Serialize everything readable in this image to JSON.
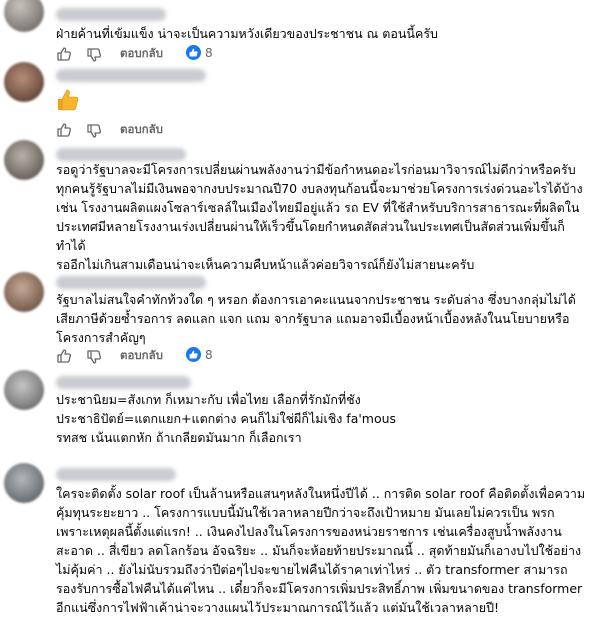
{
  "reply_label": "ตอบกลับ",
  "comments": [
    {
      "text": "ฝ่ายค้านที่เข้มแข็ง น่าจะเป็นความหวังเดียวของประชาชน ณ ตอนนี้ครับ",
      "reaction_count": "8"
    },
    {
      "text": "",
      "emoji": "thumbs-up"
    },
    {
      "text": "รอดูว่ารัฐบาลจะมีโครงการเปลี่ยนผ่านพลังงานว่ามีข้อกำหนดอะไรก่อนมาวิจารณ์ไม่ดีกว่าหรือครับ\nทุกคนรู้รัฐบาลไม่มีเงินพอจากงบประมาณปี70 งบลงทุนก้อนนี้จะมาช่วยโครงการเร่งด่วนอะไรได้บ้าง\nเช่น โรงงานผลิตแผงโซลาร์เซลล์ในเมืองไทยมีอยู่แล้ว รถ EV ที่ใช้สำหรับบริการสาธารณะที่ผลิตใน\nประเทศมีหลายโรงงานเร่งเปลี่ยนผ่านให้เร็วขึ้นโดยกำหนดสัดส่วนในประเทศเป็นสัดส่วนเพิ่มขึ้นก็ทำได้\nรออีกไม่เกินสามเดือนน่าจะเห็นความคืบหน้าแล้วค่อยวิจารณ์ก็ยังไม่สายนะครับ"
    },
    {
      "text": "รัฐบาลไม่สนใจคำทักท้วงใด ๆ หรอก ต้องการเอาคะแนนจากประชาชน ระดับล่าง ซึ่งบางกลุ่มไม่ได้\nเสียภาษีด้วยซ้ำรอการ ลดแลก แจก แถม จากรัฐบาล แถมอาจมีเบื้องหน้าเบื้องหลังในนโยบายหรือ\nโครงการสำคัญๆ",
      "reaction_count": "8"
    },
    {
      "text": "ประชานิยม=สังเกท ก็เหมาะกับ เพื่อไทย เลือกที่รักมักที่ชัง\nประชาธิปัตย์=แตกแยก+แตกต่าง คนก็ไม่ใช่ผีก็ไม่เชิง fa'mous\nรทสช เน้นแตกหัก ถ้าเกลียดมันมาก ก็เลือกเรา"
    },
    {
      "text": "ใครจะติดตั้ง solar roof เป็นล้านหรือแสนๆหลังในหนึ่งปีได้ .. การติด solar roof คือติดตั้งเพื่อความ\nคุ้มทุนระยะยาว .. โครงการแบบนี้มันใช้เวลาหลายปีกว่าจะถึงเป้าหมาย มันเลยไม่ควรเป็น พรก\nเพราะเหตุผลนี้ตั้งแต่แรก! .. เงินคงไปลงในโครงการของหน่วยราชการ เช่นเครื่องสูบน้ำพลังงาน\nสะอาด .. สี่เขียว ลดโลกร้อน อัจฉริยะ .. มันก็จะห้อยท้ายประมาณนี้ .. สุดท้ายมันก็เอางบไปใช้อย่าง\nไม่คุ้มค่า .. ยังไม่นับรวมถึงว่าปีต่อๆไปจะขายไฟคืนได้ราคาเท่าไหร่ .. ตัว transformer สามารถ\nรองรับการซื้อไฟคืนได้แค่ไหน .. เดี๋ยวก็จะมีโครงการเพิ่มประสิทธิ์ภาพ เพิ่มขนาดของ transformer\nอีกแน่ซึ่งการไฟฟ้าเค้าน่าจะวางแผนไว้ประมาณการณ์ไว้แล้ว แต่มันใช้เวลาหลายปี!"
    }
  ]
}
